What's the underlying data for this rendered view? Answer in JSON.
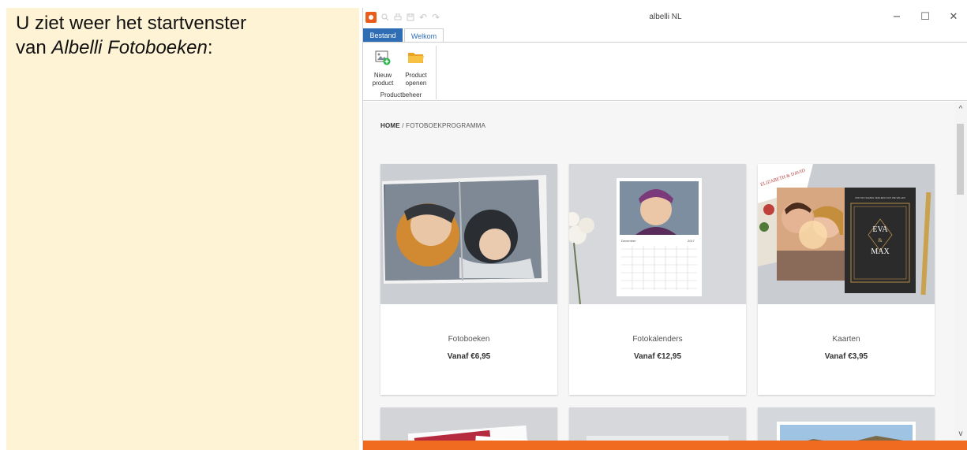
{
  "note": {
    "line1": "U ziet weer het startvenster",
    "line2_prefix": "van ",
    "line2_italic": "Albelli Fotoboeken",
    "line2_suffix": ":"
  },
  "window": {
    "title": "albelli NL"
  },
  "tabs": [
    "Bestand",
    "Welkom"
  ],
  "ribbon": {
    "buttons": [
      {
        "label_1": "Nieuw",
        "label_2": "product",
        "icon": "new-product-icon"
      },
      {
        "label_1": "Product",
        "label_2": "openen",
        "icon": "open-folder-icon"
      }
    ],
    "group": "Productbeheer"
  },
  "breadcrumb": {
    "home": "HOME",
    "sep": "/",
    "current": "FOTOBOEKPROGRAMMA"
  },
  "products": [
    {
      "name": "Fotoboeken",
      "price": "Vanaf €6,95"
    },
    {
      "name": "Fotokalenders",
      "price": "Vanaf €12,95"
    },
    {
      "name": "Kaarten",
      "price": "Vanaf €3,95"
    }
  ],
  "card_text": {
    "invite_top": "ELIZABETH & DAVID",
    "invite_line": "ZIJN WIJ SAMEN VERLIEFD DAT WE WILLEN",
    "name1": "EVA",
    "amp": "&",
    "name2": "MAX",
    "month": "December",
    "year": "2017"
  },
  "colors": {
    "accent": "#2f6db5",
    "brand_orange": "#f06a20",
    "note_bg": "#fff3d6"
  }
}
